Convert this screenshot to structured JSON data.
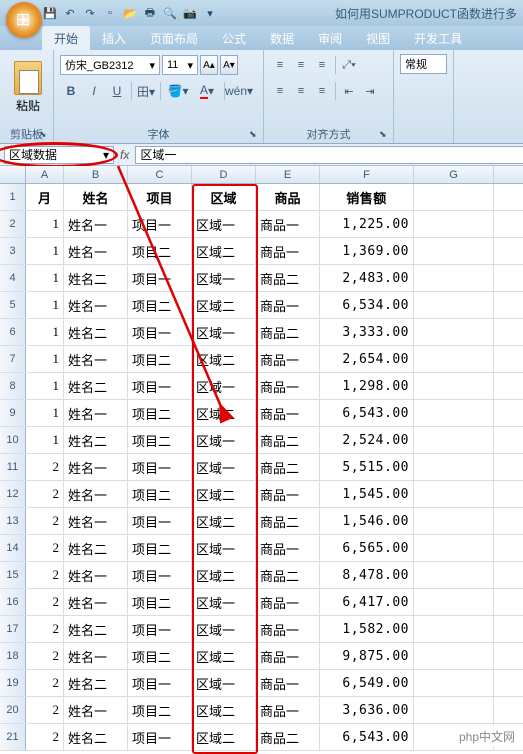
{
  "title": "如何用SUMPRODUCT函数进行多",
  "qat_items": [
    "save-icon",
    "undo-icon",
    "redo-icon",
    "new-icon",
    "open-icon",
    "print-icon",
    "preview-icon",
    "camera-icon"
  ],
  "ribbon": {
    "tabs": [
      "开始",
      "插入",
      "页面布局",
      "公式",
      "数据",
      "审阅",
      "视图",
      "开发工具"
    ],
    "active_tab": 0,
    "groups": {
      "clipboard": {
        "label": "剪贴板",
        "paste_label": "粘贴"
      },
      "font": {
        "label": "字体",
        "font_name": "仿宋_GB2312",
        "font_size": "11"
      },
      "alignment": {
        "label": "对齐方式"
      },
      "number": {
        "label": "常规"
      }
    }
  },
  "formula_bar": {
    "name_box": "区域数据",
    "fx_label": "fx",
    "formula_value": "区域一"
  },
  "columns": [
    "A",
    "B",
    "C",
    "D",
    "E",
    "F",
    "G"
  ],
  "col_widths": [
    "col-A",
    "col-B",
    "col-C",
    "col-D",
    "col-E",
    "col-F",
    "col-G"
  ],
  "headers": [
    "月",
    "姓名",
    "项目",
    "区域",
    "商品",
    "销售额"
  ],
  "chart_data": {
    "type": "table",
    "columns": [
      "月",
      "姓名",
      "项目",
      "区域",
      "商品",
      "销售额"
    ],
    "rows": [
      {
        "月": 1,
        "姓名": "姓名一",
        "项目": "项目一",
        "区域": "区域一",
        "商品": "商品一",
        "销售额": 1225.0
      },
      {
        "月": 1,
        "姓名": "姓名一",
        "项目": "项目二",
        "区域": "区域二",
        "商品": "商品一",
        "销售额": 1369.0
      },
      {
        "月": 1,
        "姓名": "姓名二",
        "项目": "项目一",
        "区域": "区域一",
        "商品": "商品二",
        "销售额": 2483.0
      },
      {
        "月": 1,
        "姓名": "姓名一",
        "项目": "项目二",
        "区域": "区域二",
        "商品": "商品一",
        "销售额": 6534.0
      },
      {
        "月": 1,
        "姓名": "姓名二",
        "项目": "项目一",
        "区域": "区域一",
        "商品": "商品二",
        "销售额": 3333.0
      },
      {
        "月": 1,
        "姓名": "姓名一",
        "项目": "项目二",
        "区域": "区域二",
        "商品": "商品一",
        "销售额": 2654.0
      },
      {
        "月": 1,
        "姓名": "姓名二",
        "项目": "项目一",
        "区域": "区域一",
        "商品": "商品一",
        "销售额": 1298.0
      },
      {
        "月": 1,
        "姓名": "姓名一",
        "项目": "项目二",
        "区域": "区域二",
        "商品": "商品一",
        "销售额": 6543.0
      },
      {
        "月": 1,
        "姓名": "姓名二",
        "项目": "项目二",
        "区域": "区域一",
        "商品": "商品二",
        "销售额": 2524.0
      },
      {
        "月": 2,
        "姓名": "姓名一",
        "项目": "项目一",
        "区域": "区域一",
        "商品": "商品二",
        "销售额": 5515.0
      },
      {
        "月": 2,
        "姓名": "姓名一",
        "项目": "项目二",
        "区域": "区域二",
        "商品": "商品一",
        "销售额": 1545.0
      },
      {
        "月": 2,
        "姓名": "姓名一",
        "项目": "项目一",
        "区域": "区域二",
        "商品": "商品二",
        "销售额": 1546.0
      },
      {
        "月": 2,
        "姓名": "姓名二",
        "项目": "项目二",
        "区域": "区域一",
        "商品": "商品一",
        "销售额": 6565.0
      },
      {
        "月": 2,
        "姓名": "姓名一",
        "项目": "项目一",
        "区域": "区域二",
        "商品": "商品二",
        "销售额": 8478.0
      },
      {
        "月": 2,
        "姓名": "姓名一",
        "项目": "项目二",
        "区域": "区域一",
        "商品": "商品一",
        "销售额": 6417.0
      },
      {
        "月": 2,
        "姓名": "姓名二",
        "项目": "项目一",
        "区域": "区域一",
        "商品": "商品一",
        "销售额": 1582.0
      },
      {
        "月": 2,
        "姓名": "姓名一",
        "项目": "项目二",
        "区域": "区域二",
        "商品": "商品一",
        "销售额": 9875.0
      },
      {
        "月": 2,
        "姓名": "姓名二",
        "项目": "项目一",
        "区域": "区域一",
        "商品": "商品一",
        "销售额": 6549.0
      },
      {
        "月": 2,
        "姓名": "姓名一",
        "项目": "项目二",
        "区域": "区域二",
        "商品": "商品一",
        "销售额": 3636.0
      },
      {
        "月": 2,
        "姓名": "姓名二",
        "项目": "项目一",
        "区域": "区域二",
        "商品": "商品二",
        "销售额": 6543.0
      }
    ]
  },
  "watermark": "php中文网"
}
